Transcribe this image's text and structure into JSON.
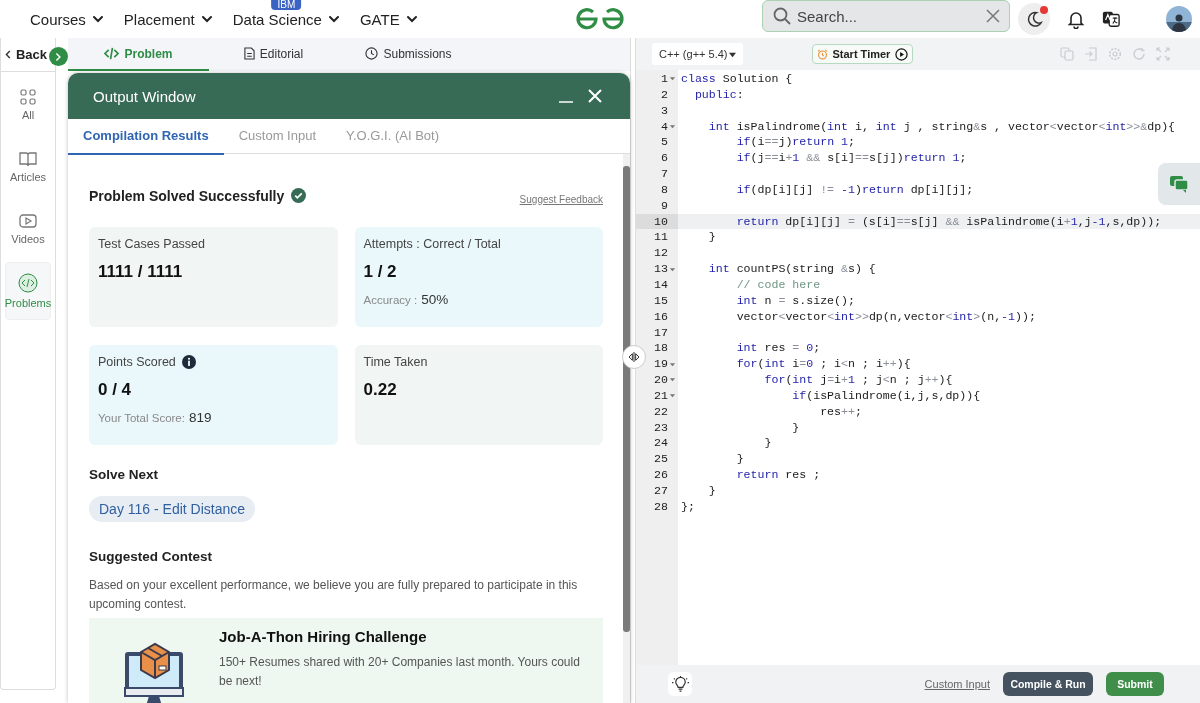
{
  "top_nav": {
    "menus": [
      {
        "label": "Courses"
      },
      {
        "label": "Placement"
      },
      {
        "label": "Data Science",
        "badge": "IBM"
      },
      {
        "label": "GATE"
      }
    ],
    "search": {
      "placeholder": "Search..."
    },
    "theme_toggle": {
      "notification_dot": true
    }
  },
  "sidebar": {
    "back": "Back",
    "items": [
      {
        "label": "All",
        "selected": false
      },
      {
        "label": "Articles",
        "selected": false
      },
      {
        "label": "Videos",
        "selected": false
      },
      {
        "label": "Problems",
        "selected": true
      }
    ]
  },
  "problem_tabs": [
    {
      "label": "Problem",
      "selected": true
    },
    {
      "label": "Editorial",
      "selected": false
    },
    {
      "label": "Submissions",
      "selected": false
    }
  ],
  "output_window": {
    "title": "Output Window",
    "tabs": [
      {
        "label": "Compilation Results",
        "selected": true
      },
      {
        "label": "Custom Input",
        "selected": false
      },
      {
        "label": "Y.O.G.I. (AI Bot)",
        "selected": false
      }
    ],
    "status": "Problem Solved Successfully",
    "feedback_link": "Suggest Feedback",
    "cards": [
      {
        "label": "Test Cases Passed",
        "value": "1111 / 1111",
        "color": "#f1f5f3"
      },
      {
        "label": "Attempts : Correct / Total",
        "value": "1 / 2",
        "note_label": "Accuracy :",
        "note_value": "50%",
        "color": "#eaf8fc"
      },
      {
        "label": "Points Scored",
        "info": true,
        "value": "0 / 4",
        "note_label": "Your Total Score:",
        "note_value": "819",
        "color": "#eaf8fc"
      },
      {
        "label": "Time Taken",
        "value": "0.22",
        "color": "#f1f5f3"
      }
    ],
    "solve_next": {
      "heading": "Solve Next",
      "problems": [
        "Day 116 - Edit Distance"
      ]
    },
    "suggested_contest": {
      "heading": "Suggested Contest",
      "text": "Based on your excellent performance, we believe you are fully prepared to participate in this upcoming contest.",
      "contest": {
        "title": "Job-A-Thon Hiring Challenge",
        "description": "150+ Resumes shared with 20+ Companies last month. Yours could be next!"
      }
    }
  },
  "editor": {
    "language": "C++ (g++ 5.4)",
    "timer_button": "Start Timer",
    "lines": [
      {
        "number": "1",
        "foldable": true,
        "active": false,
        "segments": [
          {
            "kind": "keyword",
            "text": "class"
          },
          {
            "kind": "plain",
            "text": " Solution {"
          }
        ]
      },
      {
        "number": "2",
        "foldable": false,
        "active": false,
        "segments": [
          {
            "kind": "keyword",
            "text": "  public"
          },
          {
            "kind": "plain",
            "text": ":"
          }
        ]
      },
      {
        "number": "3",
        "foldable": false,
        "active": false
      },
      {
        "number": "4",
        "foldable": true,
        "active": false,
        "segments": [
          {
            "kind": "keyword",
            "text": "    int"
          },
          {
            "kind": "plain",
            "text": " isPalindrome("
          },
          {
            "kind": "keyword",
            "text": "int"
          },
          {
            "kind": "plain",
            "text": " i, "
          },
          {
            "kind": "keyword",
            "text": "int"
          },
          {
            "kind": "plain",
            "text": " j , string"
          },
          {
            "kind": "operator",
            "text": "&"
          },
          {
            "kind": "plain",
            "text": "s , vector"
          },
          {
            "kind": "operator",
            "text": "<"
          },
          {
            "kind": "plain",
            "text": "vector"
          },
          {
            "kind": "operator",
            "text": "<"
          },
          {
            "kind": "keyword",
            "text": "int"
          },
          {
            "kind": "operator",
            "text": ">>&"
          },
          {
            "kind": "plain",
            "text": "dp){"
          }
        ]
      },
      {
        "number": "5",
        "foldable": false,
        "active": false,
        "segments": [
          {
            "kind": "keyword",
            "text": "        if"
          },
          {
            "kind": "plain",
            "text": "(i"
          },
          {
            "kind": "operator",
            "text": "=="
          },
          {
            "kind": "plain",
            "text": "j)"
          },
          {
            "kind": "keyword",
            "text": "return"
          },
          {
            "kind": "number",
            "text": " 1"
          },
          {
            "kind": "plain",
            "text": ";"
          }
        ]
      },
      {
        "number": "6",
        "foldable": false,
        "active": false,
        "segments": [
          {
            "kind": "keyword",
            "text": "        if"
          },
          {
            "kind": "plain",
            "text": "(j"
          },
          {
            "kind": "operator",
            "text": "=="
          },
          {
            "kind": "plain",
            "text": "i"
          },
          {
            "kind": "operator",
            "text": "+"
          },
          {
            "kind": "number",
            "text": "1"
          },
          {
            "kind": "operator",
            "text": " &&"
          },
          {
            "kind": "plain",
            "text": " s[i]"
          },
          {
            "kind": "operator",
            "text": "=="
          },
          {
            "kind": "plain",
            "text": "s[j])"
          },
          {
            "kind": "keyword",
            "text": "return"
          },
          {
            "kind": "number",
            "text": " 1"
          },
          {
            "kind": "plain",
            "text": ";"
          }
        ]
      },
      {
        "number": "7",
        "foldable": false,
        "active": false
      },
      {
        "number": "8",
        "foldable": false,
        "active": false,
        "segments": [
          {
            "kind": "keyword",
            "text": "        if"
          },
          {
            "kind": "plain",
            "text": "(dp[i][j] "
          },
          {
            "kind": "operator",
            "text": "!="
          },
          {
            "kind": "number",
            "text": " -1"
          },
          {
            "kind": "plain",
            "text": ")"
          },
          {
            "kind": "keyword",
            "text": "return"
          },
          {
            "kind": "plain",
            "text": " dp[i][j];"
          }
        ]
      },
      {
        "number": "9",
        "foldable": false,
        "active": false
      },
      {
        "number": "10",
        "foldable": false,
        "active": true,
        "segments": [
          {
            "kind": "keyword",
            "text": "        return"
          },
          {
            "kind": "plain",
            "text": " dp[i][j] "
          },
          {
            "kind": "operator",
            "text": "="
          },
          {
            "kind": "plain",
            "text": " (s[i]"
          },
          {
            "kind": "operator",
            "text": "=="
          },
          {
            "kind": "plain",
            "text": "s[j] "
          },
          {
            "kind": "operator",
            "text": "&&"
          },
          {
            "kind": "plain",
            "text": " isPalindrome(i"
          },
          {
            "kind": "operator",
            "text": "+"
          },
          {
            "kind": "number",
            "text": "1"
          },
          {
            "kind": "plain",
            "text": ",j"
          },
          {
            "kind": "number",
            "text": "-1"
          },
          {
            "kind": "plain",
            "text": ",s,dp));"
          }
        ]
      },
      {
        "number": "11",
        "foldable": false,
        "active": false,
        "segments": [
          {
            "kind": "plain",
            "text": "    }"
          }
        ]
      },
      {
        "number": "12",
        "foldable": false,
        "active": false
      },
      {
        "number": "13",
        "foldable": true,
        "active": false,
        "segments": [
          {
            "kind": "keyword",
            "text": "    int"
          },
          {
            "kind": "plain",
            "text": " countPS(string "
          },
          {
            "kind": "operator",
            "text": "&"
          },
          {
            "kind": "plain",
            "text": "s) {"
          }
        ]
      },
      {
        "number": "14",
        "foldable": false,
        "active": false,
        "segments": [
          {
            "kind": "comment",
            "text": "        // code here"
          }
        ]
      },
      {
        "number": "15",
        "foldable": false,
        "active": false,
        "segments": [
          {
            "kind": "keyword",
            "text": "        int"
          },
          {
            "kind": "plain",
            "text": " n "
          },
          {
            "kind": "operator",
            "text": "="
          },
          {
            "kind": "plain",
            "text": " s.size();"
          }
        ]
      },
      {
        "number": "16",
        "foldable": false,
        "active": false,
        "segments": [
          {
            "kind": "plain",
            "text": "        vector"
          },
          {
            "kind": "operator",
            "text": "<"
          },
          {
            "kind": "plain",
            "text": "vector"
          },
          {
            "kind": "operator",
            "text": "<"
          },
          {
            "kind": "keyword",
            "text": "int"
          },
          {
            "kind": "operator",
            "text": ">>"
          },
          {
            "kind": "plain",
            "text": "dp(n,vector"
          },
          {
            "kind": "operator",
            "text": "<"
          },
          {
            "kind": "keyword",
            "text": "int"
          },
          {
            "kind": "operator",
            "text": ">"
          },
          {
            "kind": "plain",
            "text": "(n,"
          },
          {
            "kind": "number",
            "text": "-1"
          },
          {
            "kind": "plain",
            "text": "));"
          }
        ]
      },
      {
        "number": "17",
        "foldable": false,
        "active": false
      },
      {
        "number": "18",
        "foldable": false,
        "active": false,
        "segments": [
          {
            "kind": "keyword",
            "text": "        int"
          },
          {
            "kind": "plain",
            "text": " res "
          },
          {
            "kind": "operator",
            "text": "="
          },
          {
            "kind": "number",
            "text": " 0"
          },
          {
            "kind": "plain",
            "text": ";"
          }
        ]
      },
      {
        "number": "19",
        "foldable": true,
        "active": false,
        "segments": [
          {
            "kind": "keyword",
            "text": "        for"
          },
          {
            "kind": "plain",
            "text": "("
          },
          {
            "kind": "keyword",
            "text": "int"
          },
          {
            "kind": "plain",
            "text": " i"
          },
          {
            "kind": "operator",
            "text": "="
          },
          {
            "kind": "number",
            "text": "0"
          },
          {
            "kind": "plain",
            "text": " ; i"
          },
          {
            "kind": "operator",
            "text": "<"
          },
          {
            "kind": "plain",
            "text": "n ; i"
          },
          {
            "kind": "operator",
            "text": "++"
          },
          {
            "kind": "plain",
            "text": "){"
          }
        ]
      },
      {
        "number": "20",
        "foldable": true,
        "active": false,
        "segments": [
          {
            "kind": "keyword",
            "text": "            for"
          },
          {
            "kind": "plain",
            "text": "("
          },
          {
            "kind": "keyword",
            "text": "int"
          },
          {
            "kind": "plain",
            "text": " j"
          },
          {
            "kind": "operator",
            "text": "="
          },
          {
            "kind": "plain",
            "text": "i"
          },
          {
            "kind": "operator",
            "text": "+"
          },
          {
            "kind": "number",
            "text": "1"
          },
          {
            "kind": "plain",
            "text": " ; j"
          },
          {
            "kind": "operator",
            "text": "<"
          },
          {
            "kind": "plain",
            "text": "n ; j"
          },
          {
            "kind": "operator",
            "text": "++"
          },
          {
            "kind": "plain",
            "text": "){"
          }
        ]
      },
      {
        "number": "21",
        "foldable": true,
        "active": false,
        "segments": [
          {
            "kind": "keyword",
            "text": "                if"
          },
          {
            "kind": "plain",
            "text": "(isPalindrome(i,j,s,dp)){"
          }
        ]
      },
      {
        "number": "22",
        "foldable": false,
        "active": false,
        "segments": [
          {
            "kind": "plain",
            "text": "                    res"
          },
          {
            "kind": "operator",
            "text": "++"
          },
          {
            "kind": "plain",
            "text": ";"
          }
        ]
      },
      {
        "number": "23",
        "foldable": false,
        "active": false,
        "segments": [
          {
            "kind": "plain",
            "text": "                }"
          }
        ]
      },
      {
        "number": "24",
        "foldable": false,
        "active": false,
        "segments": [
          {
            "kind": "plain",
            "text": "            }"
          }
        ]
      },
      {
        "number": "25",
        "foldable": false,
        "active": false,
        "segments": [
          {
            "kind": "plain",
            "text": "        }"
          }
        ]
      },
      {
        "number": "26",
        "foldable": false,
        "active": false,
        "segments": [
          {
            "kind": "keyword",
            "text": "        return"
          },
          {
            "kind": "plain",
            "text": " res ;"
          }
        ]
      },
      {
        "number": "27",
        "foldable": false,
        "active": false,
        "segments": [
          {
            "kind": "plain",
            "text": "    }"
          }
        ]
      },
      {
        "number": "28",
        "foldable": false,
        "active": false,
        "segments": [
          {
            "kind": "plain",
            "text": "};"
          }
        ]
      }
    ]
  },
  "footer": {
    "custom_input": "Custom Input",
    "compile_button": "Compile & Run",
    "submit_button": "Submit"
  }
}
